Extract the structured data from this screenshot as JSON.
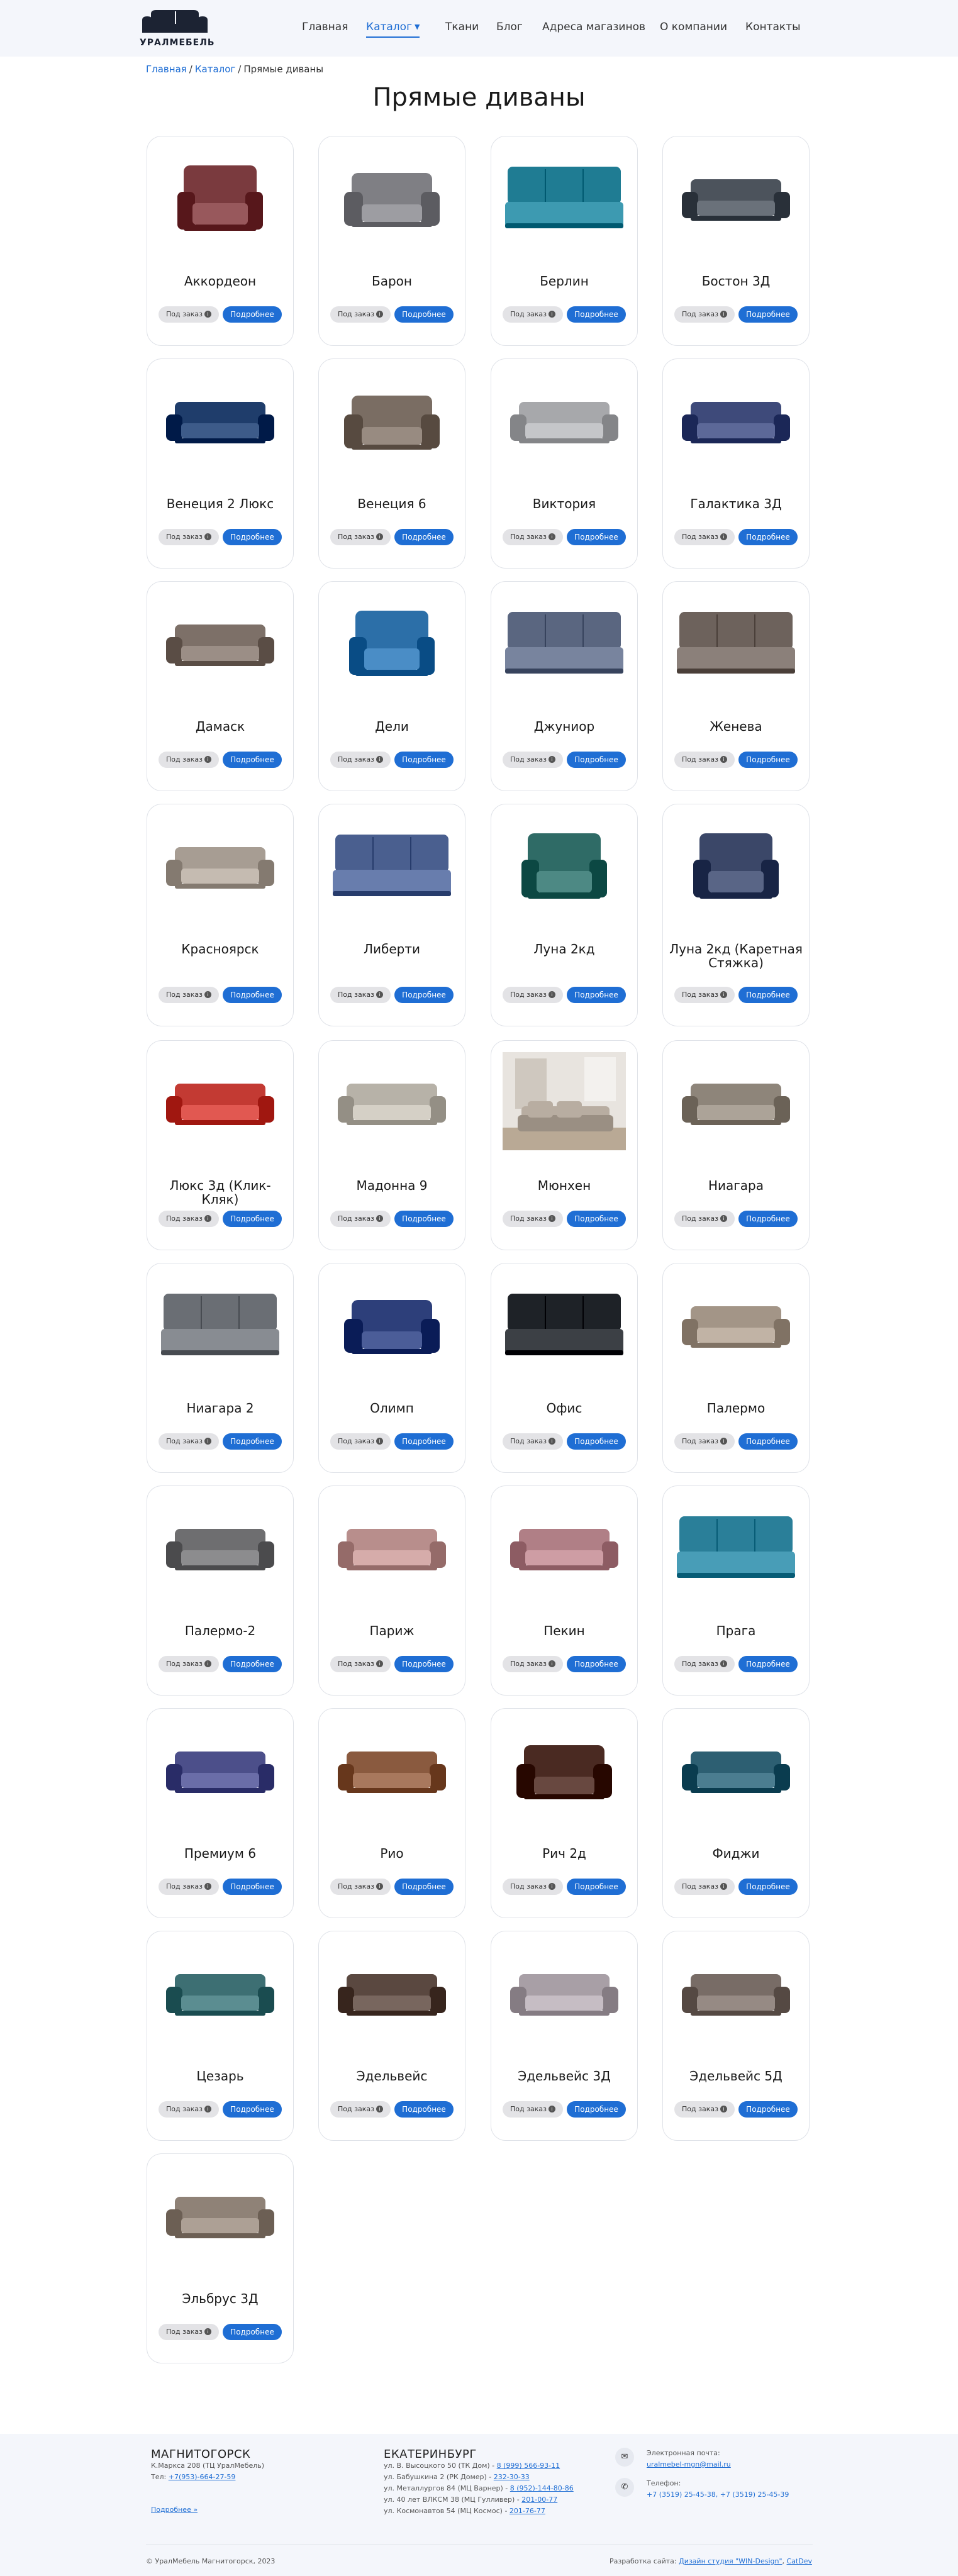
{
  "brand": {
    "name": "УРАЛМЕБЕЛЬ"
  },
  "nav": {
    "items": [
      {
        "label": "Главная"
      },
      {
        "label": "Каталог",
        "active": true
      },
      {
        "label": "Ткани"
      },
      {
        "label": "Блог"
      },
      {
        "label": "Адреса магазинов"
      },
      {
        "label": "О компании"
      },
      {
        "label": "Контакты"
      }
    ]
  },
  "breadcrumb": {
    "home": "Главная",
    "catalog": "Каталог",
    "current": "Прямые диваны",
    "separator": "/"
  },
  "page_title": "Прямые диваны",
  "buttons": {
    "order": "Под заказ",
    "order_icon": "i",
    "details": "Подробнее"
  },
  "products": [
    {
      "name": "Аккордеон",
      "color": "#7a3a3e",
      "style": "chair"
    },
    {
      "name": "Барон",
      "color": "#7f7f84",
      "style": "loveseat"
    },
    {
      "name": "Берлин",
      "color": "#1f7c93",
      "style": "wide"
    },
    {
      "name": "Бостон 3Д",
      "color": "#4c535c",
      "style": "sofa"
    },
    {
      "name": "Венеция 2 Люкс",
      "color": "#1f3d6b",
      "style": "sofa"
    },
    {
      "name": "Венеция 6",
      "color": "#7a6d63",
      "style": "loveseat"
    },
    {
      "name": "Виктория",
      "color": "#a7a8ab",
      "style": "sofa"
    },
    {
      "name": "Галактика 3Д",
      "color": "#3e4a7a",
      "style": "sofa"
    },
    {
      "name": "Дамаск",
      "color": "#7d7068",
      "style": "sofa"
    },
    {
      "name": "Дели",
      "color": "#2c6fa8",
      "style": "chair"
    },
    {
      "name": "Джуниор",
      "color": "#5a6680",
      "style": "wide"
    },
    {
      "name": "Женева",
      "color": "#6d625c",
      "style": "wide"
    },
    {
      "name": "Красноярск",
      "color": "#a79d93",
      "style": "sofa"
    },
    {
      "name": "Либерти",
      "color": "#4a5f8f",
      "style": "wide"
    },
    {
      "name": "Луна 2кд",
      "color": "#2f6b66",
      "style": "chair"
    },
    {
      "name": "Луна 2кд (Каретная Стяжка)",
      "color": "#3b4768",
      "style": "chair"
    },
    {
      "name": "Люкс 3д (Клик-Кляк)",
      "color": "#c33a33",
      "style": "sofa"
    },
    {
      "name": "Мадонна 9",
      "color": "#b7b2a8",
      "style": "sofa"
    },
    {
      "name": "Мюнхен",
      "color": "#9a8f83",
      "style": "room"
    },
    {
      "name": "Ниагара",
      "color": "#8e857a",
      "style": "sofa"
    },
    {
      "name": "Ниагара 2",
      "color": "#6a6e74",
      "style": "wide"
    },
    {
      "name": "Олимп",
      "color": "#2d3f7a",
      "style": "loveseat"
    },
    {
      "name": "Офис",
      "color": "#1e2227",
      "style": "wide"
    },
    {
      "name": "Палермо",
      "color": "#a39587",
      "style": "sofa"
    },
    {
      "name": "Палермо-2",
      "color": "#6e6e70",
      "style": "sofa"
    },
    {
      "name": "Париж",
      "color": "#b88e8c",
      "style": "sofa"
    },
    {
      "name": "Пекин",
      "color": "#b07f86",
      "style": "sofa"
    },
    {
      "name": "Прага",
      "color": "#2a7f99",
      "style": "wide"
    },
    {
      "name": "Премиум 6",
      "color": "#4c4f8a",
      "style": "sofa"
    },
    {
      "name": "Рио",
      "color": "#8a5a3f",
      "style": "sofa"
    },
    {
      "name": "Рич 2д",
      "color": "#4a2a22",
      "style": "loveseat"
    },
    {
      "name": "Фиджи",
      "color": "#2d5f72",
      "style": "sofa"
    },
    {
      "name": "Цезарь",
      "color": "#3d6f73",
      "style": "sofa"
    },
    {
      "name": "Эдельвейс",
      "color": "#5a4840",
      "style": "sofa"
    },
    {
      "name": "Эдельвейс 3Д",
      "color": "#a89fa6",
      "style": "sofa"
    },
    {
      "name": "Эдельвейс 5Д",
      "color": "#786c66",
      "style": "sofa"
    },
    {
      "name": "Эльбрус 3Д",
      "color": "#8f8277",
      "style": "sofa"
    }
  ],
  "footer": {
    "magnitogorsk": {
      "city": "МАГНИТОГОРСК",
      "address": "К.Маркса 208 (ТЦ УралМебель)",
      "phone_label": "Тел:",
      "phone": "+7(953)-664-27-59",
      "more": "Подробнее »"
    },
    "ekaterinburg": {
      "city": "ЕКАТЕРИНБУРГ",
      "stores": [
        {
          "address": "ул. В. Высоцкого 50 (ТК Дом) -",
          "phone": "8 (999) 566-93-11"
        },
        {
          "address": "ул. Бабушкина 2 (РК Домер) -",
          "phone": "232-30-33"
        },
        {
          "address": "ул. Металлургов 84 (МЦ Варнер) -",
          "phone": "8 (952)-144-80-86"
        },
        {
          "address": "ул. 40 лет ВЛКСМ 38 (МЦ Гулливер) -",
          "phone": "201-00-77"
        },
        {
          "address": "ул. Космонавтов 54 (МЦ Космос) -",
          "phone": "201-76-77"
        }
      ]
    },
    "email": {
      "label": "Электронная почта:",
      "value": "uralmebel-mgn@mail.ru",
      "icon": "mail-icon"
    },
    "phones": {
      "label": "Телефон:",
      "value": "+7 (3519) 25-45-38, +7 (3519) 25-45-39",
      "icon": "phone-icon"
    },
    "copyright": "© УралМебель Магнитогорск, 2023",
    "developer_label": "Разработка сайта:",
    "developer_link": "Дизайн студия \"WIN-Design\"",
    "developer_suffix": "CatDev"
  },
  "colors": {
    "accent": "#1f6ed4",
    "order_button": "#e3e3e6",
    "header_bg": "#f4f6fb",
    "card_border": "#dfe2e8"
  }
}
